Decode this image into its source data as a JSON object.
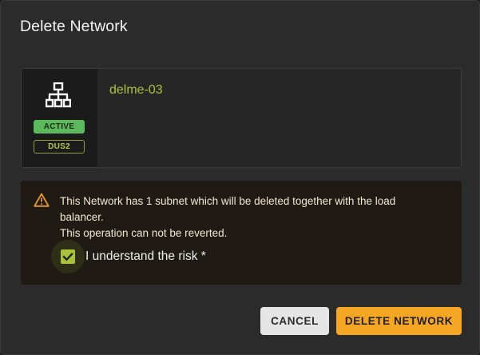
{
  "dialog": {
    "title": "Delete Network"
  },
  "network": {
    "name": "delme-03",
    "status": "ACTIVE",
    "region": "DUS2",
    "icon": "network-icon"
  },
  "warning": {
    "icon": "warning-triangle-icon",
    "line1": "This Network has 1 subnet which will be deleted together with the load balancer.",
    "line2": "This operation can not be reverted.",
    "checkbox_label": "I understand the risk",
    "required_marker": "*",
    "checkbox_checked": true
  },
  "actions": {
    "cancel_label": "CANCEL",
    "delete_label": "DELETE NETWORK"
  },
  "colors": {
    "accent": "#a9c23a",
    "active": "#5cb85c",
    "danger_button": "#f5a623",
    "warning_icon": "#e89a2a"
  }
}
